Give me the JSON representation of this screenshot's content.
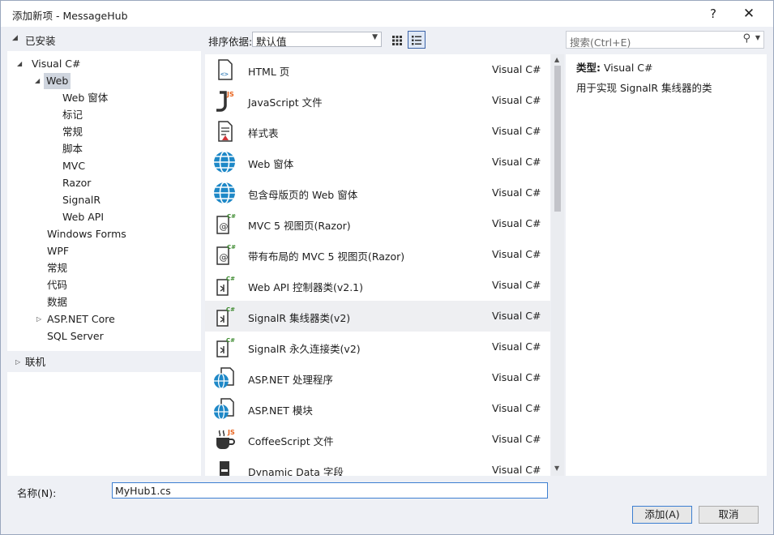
{
  "window": {
    "title": "添加新项 - MessageHub",
    "help": "?",
    "close": "✕"
  },
  "left": {
    "installed": "已安装",
    "tree": [
      "Visual C#",
      "Web",
      "Web 窗体",
      "标记",
      "常规",
      "脚本",
      "MVC",
      "Razor",
      "SignalR",
      "Web API",
      "Windows Forms",
      "WPF",
      "常规",
      "代码",
      "数据",
      "ASP.NET Core",
      "SQL Server"
    ],
    "online": "联机"
  },
  "sort": {
    "label": "排序依据:",
    "value": "默认值"
  },
  "items": [
    {
      "name": "HTML 页",
      "lang": "Visual C#",
      "icon": "html-file-icon"
    },
    {
      "name": "JavaScript 文件",
      "lang": "Visual C#",
      "icon": "javascript-file-icon"
    },
    {
      "name": "样式表",
      "lang": "Visual C#",
      "icon": "stylesheet-icon"
    },
    {
      "name": "Web 窗体",
      "lang": "Visual C#",
      "icon": "globe-icon"
    },
    {
      "name": "包含母版页的 Web 窗体",
      "lang": "Visual C#",
      "icon": "globe-icon"
    },
    {
      "name": "MVC 5 视图页(Razor)",
      "lang": "Visual C#",
      "icon": "razor-view-icon"
    },
    {
      "name": "带有布局的 MVC 5 视图页(Razor)",
      "lang": "Visual C#",
      "icon": "razor-view-icon"
    },
    {
      "name": "Web API 控制器类(v2.1)",
      "lang": "Visual C#",
      "icon": "csharp-class-icon"
    },
    {
      "name": "SignalR 集线器类(v2)",
      "lang": "Visual C#",
      "icon": "csharp-class-icon"
    },
    {
      "name": "SignalR 永久连接类(v2)",
      "lang": "Visual C#",
      "icon": "csharp-class-icon"
    },
    {
      "name": "ASP.NET 处理程序",
      "lang": "Visual C#",
      "icon": "globe-file-icon"
    },
    {
      "name": "ASP.NET 模块",
      "lang": "Visual C#",
      "icon": "globe-file-icon"
    },
    {
      "name": "CoffeeScript 文件",
      "lang": "Visual C#",
      "icon": "coffee-cup-icon"
    },
    {
      "name": "Dynamic Data 字段",
      "lang": "Visual C#",
      "icon": "dynamic-data-icon"
    }
  ],
  "selected_index": 8,
  "search": {
    "placeholder": "搜索(Ctrl+E)"
  },
  "detail": {
    "type_label": "类型:",
    "type_value": "Visual C#",
    "description": "用于实现 SignalR 集线器的类"
  },
  "bottom": {
    "name_label": "名称(N):",
    "name_value": "MyHub1.cs",
    "add": "添加(A)",
    "cancel": "取消"
  },
  "colors": {
    "accent": "#3c7fd1",
    "tree_selected": "#cfd5de",
    "row_selected": "#eeeff2",
    "chrome": "#eef0f5"
  }
}
